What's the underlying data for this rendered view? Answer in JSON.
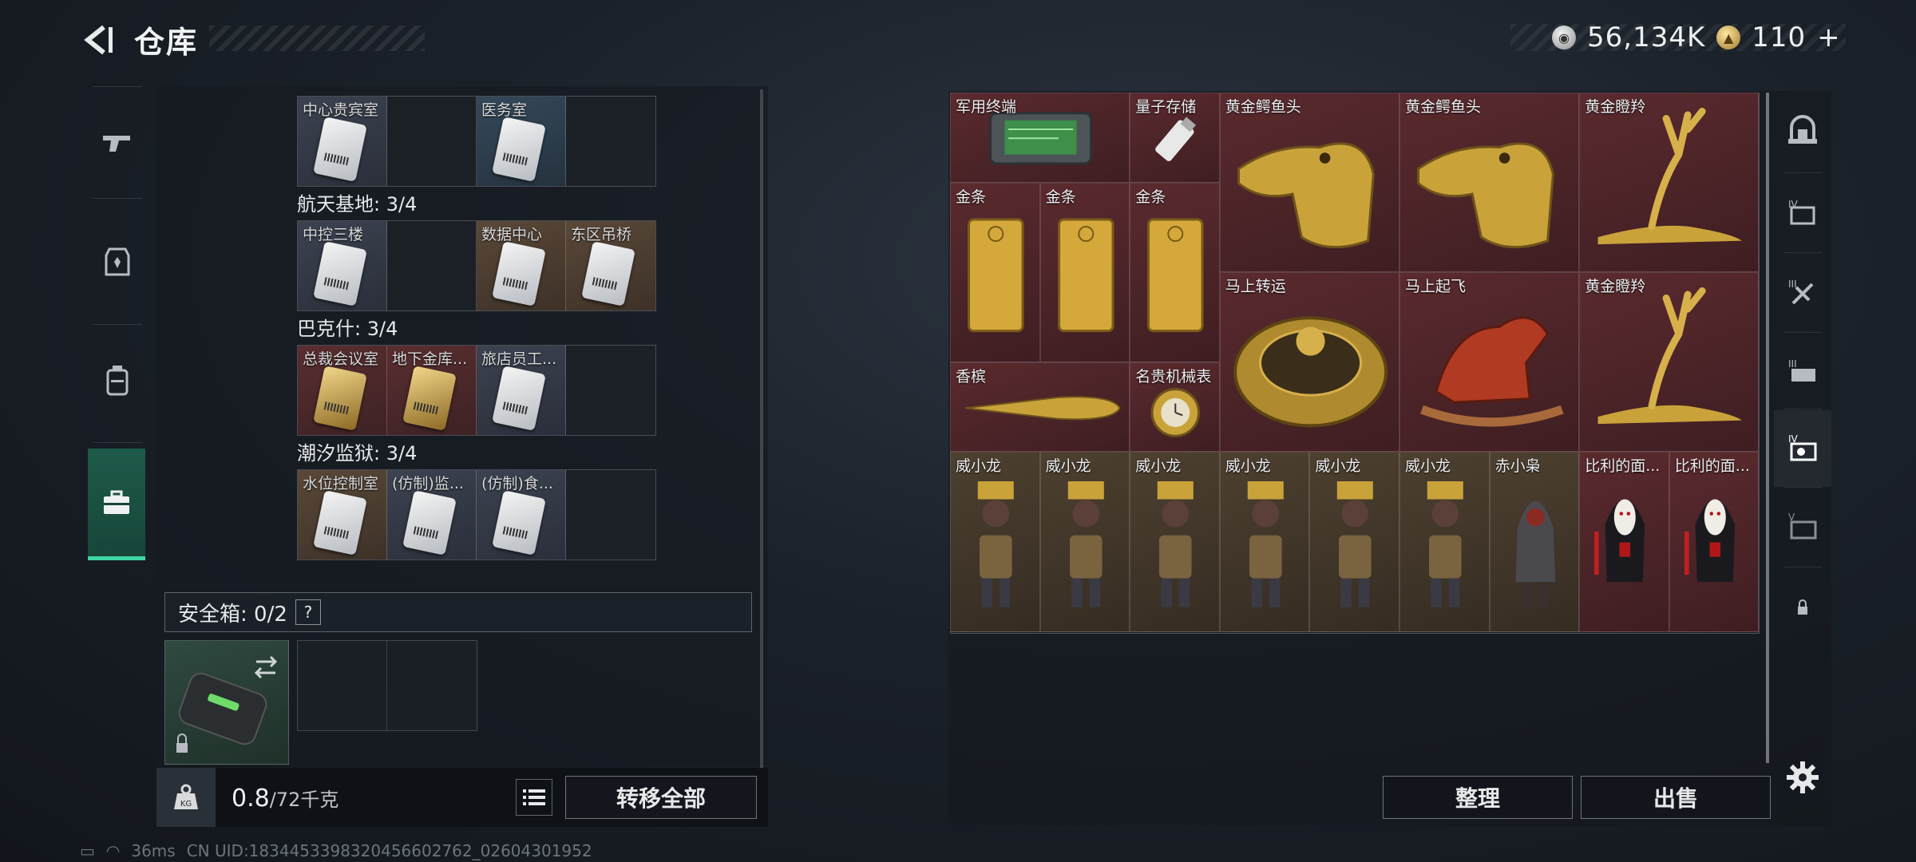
{
  "header": {
    "title": "仓库",
    "back_icon": "back-arrow-icon",
    "currency_silver": "56,134K",
    "currency_gold": "110",
    "currency_gold_plus": "+"
  },
  "left_nav": [
    {
      "icon": "gun-icon"
    },
    {
      "icon": "armor-icon"
    },
    {
      "icon": "backpack-icon"
    },
    {
      "icon": "toolbox-icon",
      "active": true
    }
  ],
  "key_sections": [
    {
      "title": "",
      "slots": [
        {
          "label": "中心贵宾室",
          "color": "grey"
        },
        {
          "label": "",
          "color": "empty"
        },
        {
          "label": "医务室",
          "color": "blue"
        },
        {
          "label": "",
          "color": "empty"
        }
      ]
    },
    {
      "title": "航天基地: 3/4",
      "slots": [
        {
          "label": "中控三楼",
          "color": "grey"
        },
        {
          "label": "",
          "color": "empty"
        },
        {
          "label": "数据中心",
          "color": "brown"
        },
        {
          "label": "东区吊桥",
          "color": "brown"
        }
      ]
    },
    {
      "title": "巴克什: 3/4",
      "slots": [
        {
          "label": "总裁会议室",
          "color": "red"
        },
        {
          "label": "地下金库...",
          "color": "red"
        },
        {
          "label": "旅店员工...",
          "color": "grey"
        },
        {
          "label": "",
          "color": "empty"
        }
      ]
    },
    {
      "title": "潮汐监狱: 3/4",
      "slots": [
        {
          "label": "水位控制室",
          "color": "brown"
        },
        {
          "label": "(仿制)监...",
          "color": "grey"
        },
        {
          "label": "(仿制)食...",
          "color": "grey"
        },
        {
          "label": "",
          "color": "empty"
        }
      ]
    }
  ],
  "safe": {
    "label": "安全箱: 0/2",
    "help": "?"
  },
  "weight": {
    "current": "0.8",
    "max": "/72千克"
  },
  "buttons": {
    "transfer_all": "转移全部",
    "sort": "整理",
    "sell": "出售"
  },
  "status": {
    "ping": "36ms",
    "uid": "CN UID:1834453398320456602762_02604301952"
  },
  "items": [
    {
      "name": "军用终端",
      "kind": "terminal",
      "rarity": "red"
    },
    {
      "name": "量子存储",
      "kind": "usb",
      "rarity": "red"
    },
    {
      "name": "黄金鳄鱼头",
      "kind": "croc",
      "rarity": "red"
    },
    {
      "name": "黄金鳄鱼头",
      "kind": "croc",
      "rarity": "red"
    },
    {
      "name": "黄金瞪羚",
      "kind": "gazelle",
      "rarity": "red"
    },
    {
      "name": "金条",
      "kind": "goldbar",
      "rarity": "red"
    },
    {
      "name": "金条",
      "kind": "goldbar",
      "rarity": "red"
    },
    {
      "name": "金条",
      "kind": "goldbar",
      "rarity": "red"
    },
    {
      "name": "马上转运",
      "kind": "disc",
      "rarity": "red"
    },
    {
      "name": "马上起飞",
      "kind": "horse",
      "rarity": "red"
    },
    {
      "name": "黄金瞪羚",
      "kind": "gazelle",
      "rarity": "red"
    },
    {
      "name": "香槟",
      "kind": "champagne",
      "rarity": "red"
    },
    {
      "name": "名贵机械表",
      "kind": "watch",
      "rarity": "red"
    },
    {
      "name": "威小龙",
      "kind": "figure",
      "rarity": "brown"
    },
    {
      "name": "威小龙",
      "kind": "figure",
      "rarity": "brown"
    },
    {
      "name": "威小龙",
      "kind": "figure",
      "rarity": "brown"
    },
    {
      "name": "威小龙",
      "kind": "figure",
      "rarity": "brown"
    },
    {
      "name": "威小龙",
      "kind": "figure",
      "rarity": "brown"
    },
    {
      "name": "威小龙",
      "kind": "figure",
      "rarity": "brown"
    },
    {
      "name": "赤小枭",
      "kind": "hood",
      "rarity": "brown"
    },
    {
      "name": "比利的面...",
      "kind": "puppet",
      "rarity": "red"
    },
    {
      "name": "比利的面...",
      "kind": "puppet",
      "rarity": "red"
    }
  ],
  "right_nav": [
    {
      "icon": "vault-icon"
    },
    {
      "icon": "folder-iv-icon"
    },
    {
      "icon": "tool-iii-icon"
    },
    {
      "icon": "case-iii-icon"
    },
    {
      "icon": "box-iv-icon",
      "active": true
    },
    {
      "icon": "box-v-icon"
    },
    {
      "icon": "lock-icon"
    }
  ],
  "colors": {
    "accent": "#3fd6a6",
    "rarity_red": "#5a2a2e",
    "rarity_brown": "#4d4030"
  }
}
